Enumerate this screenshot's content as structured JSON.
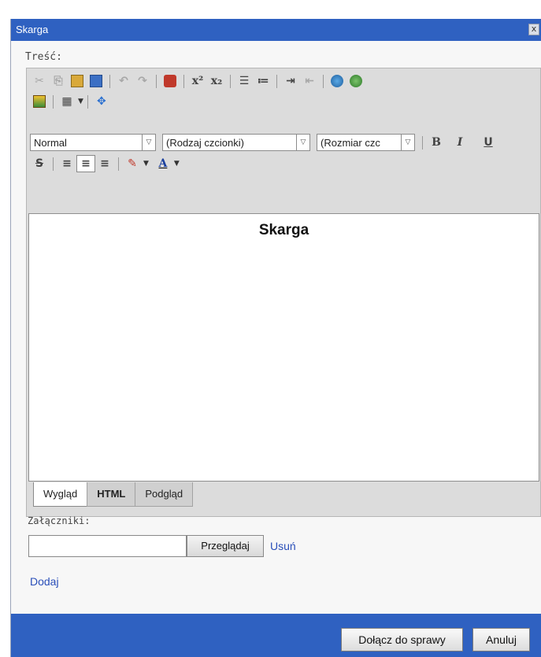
{
  "window": {
    "title": "Skarga",
    "close_glyph": "x"
  },
  "form": {
    "content_label": "Treść:",
    "attachments_label": "Załączniki:"
  },
  "editor": {
    "format_select": "Normal",
    "font_select": "(Rodzaj czcionki)",
    "size_select": "(Rozmiar czc",
    "document_heading": "Skarga",
    "tabs": [
      "Wygląd",
      "HTML",
      "Podgląd"
    ],
    "active_tab": "Wygląd"
  },
  "attachments": {
    "browse_label": "Przeglądaj",
    "remove_label": "Usuń",
    "add_label": "Dodaj"
  },
  "footer": {
    "attach_button": "Dołącz do sprawy",
    "cancel_button": "Anuluj"
  },
  "icons": {
    "toolbar_row1": [
      "cut-icon",
      "copy-icon",
      "paste-icon",
      "paste-from-word-icon",
      "undo-icon",
      "redo-icon",
      "spell-check-icon",
      "superscript-icon",
      "subscript-icon",
      "ordered-list-icon",
      "unordered-list-icon",
      "indent-icon",
      "outdent-icon",
      "insert-link-icon",
      "remove-link-icon"
    ],
    "toolbar_row2": [
      "insert-image-icon",
      "insert-table-icon",
      "resize-icon"
    ]
  },
  "colors": {
    "titlebar": "#2f61c1",
    "link": "#2a4fb9"
  }
}
